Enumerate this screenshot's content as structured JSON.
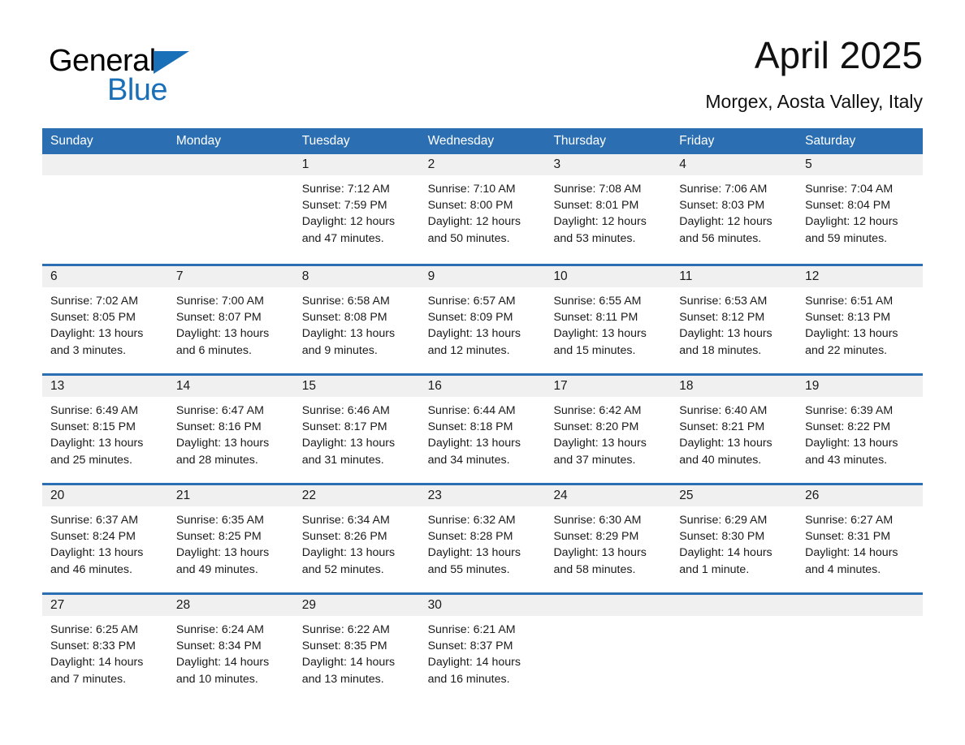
{
  "brand": {
    "name_part1": "General",
    "name_part2": "Blue",
    "triangle_icon": "brand-triangle-icon",
    "colors": {
      "blue": "#1a70b8",
      "black": "#000000"
    }
  },
  "header": {
    "title": "April 2025",
    "subtitle": "Morgex, Aosta Valley, Italy"
  },
  "theme": {
    "header_blue": "#2b6fb2",
    "day_band_gray": "#f0f0f0",
    "cell_white": "#ffffff",
    "text": "#1a1a1a"
  },
  "weekdays": [
    "Sunday",
    "Monday",
    "Tuesday",
    "Wednesday",
    "Thursday",
    "Friday",
    "Saturday"
  ],
  "weeks": [
    [
      {
        "day": "",
        "sunrise": "",
        "sunset": "",
        "daylight_line1": "",
        "daylight_line2": ""
      },
      {
        "day": "",
        "sunrise": "",
        "sunset": "",
        "daylight_line1": "",
        "daylight_line2": ""
      },
      {
        "day": "1",
        "sunrise": "Sunrise: 7:12 AM",
        "sunset": "Sunset: 7:59 PM",
        "daylight_line1": "Daylight: 12 hours",
        "daylight_line2": "and 47 minutes."
      },
      {
        "day": "2",
        "sunrise": "Sunrise: 7:10 AM",
        "sunset": "Sunset: 8:00 PM",
        "daylight_line1": "Daylight: 12 hours",
        "daylight_line2": "and 50 minutes."
      },
      {
        "day": "3",
        "sunrise": "Sunrise: 7:08 AM",
        "sunset": "Sunset: 8:01 PM",
        "daylight_line1": "Daylight: 12 hours",
        "daylight_line2": "and 53 minutes."
      },
      {
        "day": "4",
        "sunrise": "Sunrise: 7:06 AM",
        "sunset": "Sunset: 8:03 PM",
        "daylight_line1": "Daylight: 12 hours",
        "daylight_line2": "and 56 minutes."
      },
      {
        "day": "5",
        "sunrise": "Sunrise: 7:04 AM",
        "sunset": "Sunset: 8:04 PM",
        "daylight_line1": "Daylight: 12 hours",
        "daylight_line2": "and 59 minutes."
      }
    ],
    [
      {
        "day": "6",
        "sunrise": "Sunrise: 7:02 AM",
        "sunset": "Sunset: 8:05 PM",
        "daylight_line1": "Daylight: 13 hours",
        "daylight_line2": "and 3 minutes."
      },
      {
        "day": "7",
        "sunrise": "Sunrise: 7:00 AM",
        "sunset": "Sunset: 8:07 PM",
        "daylight_line1": "Daylight: 13 hours",
        "daylight_line2": "and 6 minutes."
      },
      {
        "day": "8",
        "sunrise": "Sunrise: 6:58 AM",
        "sunset": "Sunset: 8:08 PM",
        "daylight_line1": "Daylight: 13 hours",
        "daylight_line2": "and 9 minutes."
      },
      {
        "day": "9",
        "sunrise": "Sunrise: 6:57 AM",
        "sunset": "Sunset: 8:09 PM",
        "daylight_line1": "Daylight: 13 hours",
        "daylight_line2": "and 12 minutes."
      },
      {
        "day": "10",
        "sunrise": "Sunrise: 6:55 AM",
        "sunset": "Sunset: 8:11 PM",
        "daylight_line1": "Daylight: 13 hours",
        "daylight_line2": "and 15 minutes."
      },
      {
        "day": "11",
        "sunrise": "Sunrise: 6:53 AM",
        "sunset": "Sunset: 8:12 PM",
        "daylight_line1": "Daylight: 13 hours",
        "daylight_line2": "and 18 minutes."
      },
      {
        "day": "12",
        "sunrise": "Sunrise: 6:51 AM",
        "sunset": "Sunset: 8:13 PM",
        "daylight_line1": "Daylight: 13 hours",
        "daylight_line2": "and 22 minutes."
      }
    ],
    [
      {
        "day": "13",
        "sunrise": "Sunrise: 6:49 AM",
        "sunset": "Sunset: 8:15 PM",
        "daylight_line1": "Daylight: 13 hours",
        "daylight_line2": "and 25 minutes."
      },
      {
        "day": "14",
        "sunrise": "Sunrise: 6:47 AM",
        "sunset": "Sunset: 8:16 PM",
        "daylight_line1": "Daylight: 13 hours",
        "daylight_line2": "and 28 minutes."
      },
      {
        "day": "15",
        "sunrise": "Sunrise: 6:46 AM",
        "sunset": "Sunset: 8:17 PM",
        "daylight_line1": "Daylight: 13 hours",
        "daylight_line2": "and 31 minutes."
      },
      {
        "day": "16",
        "sunrise": "Sunrise: 6:44 AM",
        "sunset": "Sunset: 8:18 PM",
        "daylight_line1": "Daylight: 13 hours",
        "daylight_line2": "and 34 minutes."
      },
      {
        "day": "17",
        "sunrise": "Sunrise: 6:42 AM",
        "sunset": "Sunset: 8:20 PM",
        "daylight_line1": "Daylight: 13 hours",
        "daylight_line2": "and 37 minutes."
      },
      {
        "day": "18",
        "sunrise": "Sunrise: 6:40 AM",
        "sunset": "Sunset: 8:21 PM",
        "daylight_line1": "Daylight: 13 hours",
        "daylight_line2": "and 40 minutes."
      },
      {
        "day": "19",
        "sunrise": "Sunrise: 6:39 AM",
        "sunset": "Sunset: 8:22 PM",
        "daylight_line1": "Daylight: 13 hours",
        "daylight_line2": "and 43 minutes."
      }
    ],
    [
      {
        "day": "20",
        "sunrise": "Sunrise: 6:37 AM",
        "sunset": "Sunset: 8:24 PM",
        "daylight_line1": "Daylight: 13 hours",
        "daylight_line2": "and 46 minutes."
      },
      {
        "day": "21",
        "sunrise": "Sunrise: 6:35 AM",
        "sunset": "Sunset: 8:25 PM",
        "daylight_line1": "Daylight: 13 hours",
        "daylight_line2": "and 49 minutes."
      },
      {
        "day": "22",
        "sunrise": "Sunrise: 6:34 AM",
        "sunset": "Sunset: 8:26 PM",
        "daylight_line1": "Daylight: 13 hours",
        "daylight_line2": "and 52 minutes."
      },
      {
        "day": "23",
        "sunrise": "Sunrise: 6:32 AM",
        "sunset": "Sunset: 8:28 PM",
        "daylight_line1": "Daylight: 13 hours",
        "daylight_line2": "and 55 minutes."
      },
      {
        "day": "24",
        "sunrise": "Sunrise: 6:30 AM",
        "sunset": "Sunset: 8:29 PM",
        "daylight_line1": "Daylight: 13 hours",
        "daylight_line2": "and 58 minutes."
      },
      {
        "day": "25",
        "sunrise": "Sunrise: 6:29 AM",
        "sunset": "Sunset: 8:30 PM",
        "daylight_line1": "Daylight: 14 hours",
        "daylight_line2": "and 1 minute."
      },
      {
        "day": "26",
        "sunrise": "Sunrise: 6:27 AM",
        "sunset": "Sunset: 8:31 PM",
        "daylight_line1": "Daylight: 14 hours",
        "daylight_line2": "and 4 minutes."
      }
    ],
    [
      {
        "day": "27",
        "sunrise": "Sunrise: 6:25 AM",
        "sunset": "Sunset: 8:33 PM",
        "daylight_line1": "Daylight: 14 hours",
        "daylight_line2": "and 7 minutes."
      },
      {
        "day": "28",
        "sunrise": "Sunrise: 6:24 AM",
        "sunset": "Sunset: 8:34 PM",
        "daylight_line1": "Daylight: 14 hours",
        "daylight_line2": "and 10 minutes."
      },
      {
        "day": "29",
        "sunrise": "Sunrise: 6:22 AM",
        "sunset": "Sunset: 8:35 PM",
        "daylight_line1": "Daylight: 14 hours",
        "daylight_line2": "and 13 minutes."
      },
      {
        "day": "30",
        "sunrise": "Sunrise: 6:21 AM",
        "sunset": "Sunset: 8:37 PM",
        "daylight_line1": "Daylight: 14 hours",
        "daylight_line2": "and 16 minutes."
      },
      {
        "day": "",
        "sunrise": "",
        "sunset": "",
        "daylight_line1": "",
        "daylight_line2": ""
      },
      {
        "day": "",
        "sunrise": "",
        "sunset": "",
        "daylight_line1": "",
        "daylight_line2": ""
      },
      {
        "day": "",
        "sunrise": "",
        "sunset": "",
        "daylight_line1": "",
        "daylight_line2": ""
      }
    ]
  ]
}
